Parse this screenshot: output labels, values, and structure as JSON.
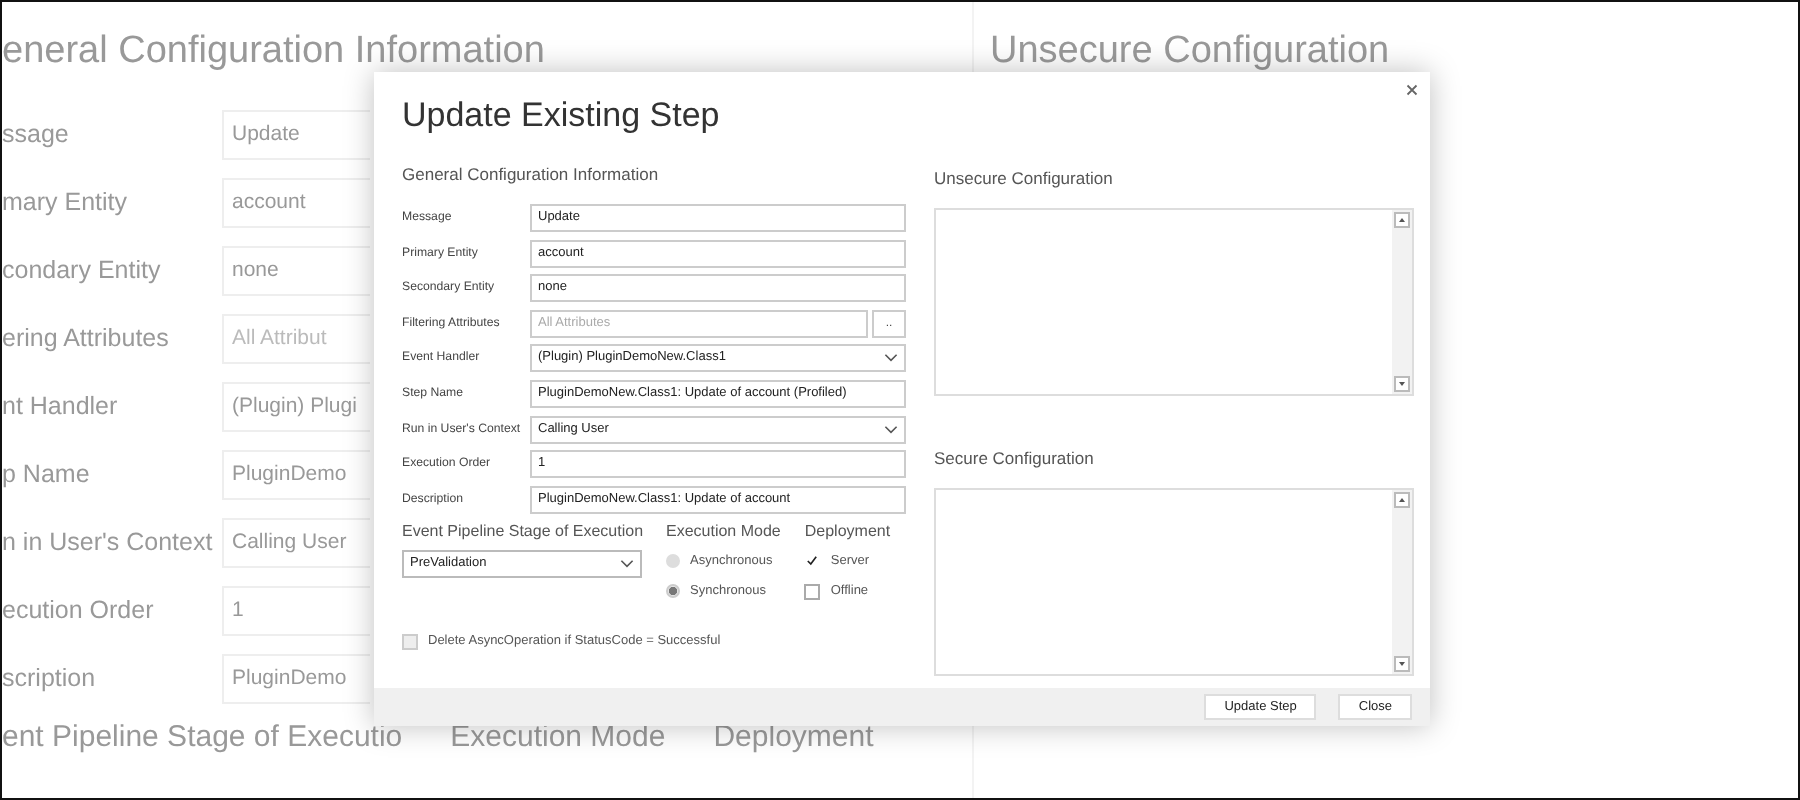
{
  "background_page": {
    "title": "eneral Configuration Information",
    "right_title": "Unsecure  Configuration",
    "rows": [
      {
        "label": "ssage",
        "value": "Update"
      },
      {
        "label": "mary Entity",
        "value": "account"
      },
      {
        "label": "condary Entity",
        "value": "none"
      },
      {
        "label": "ering Attributes",
        "placeholder": "All Attribut"
      },
      {
        "label": "nt Handler",
        "value": "(Plugin) Plugi"
      },
      {
        "label": "p Name",
        "value": "PluginDemo"
      },
      {
        "label": "n in User's Context",
        "value": "Calling User"
      },
      {
        "label": "ecution Order",
        "value": "1"
      },
      {
        "label": "scription",
        "value": "PluginDemo"
      }
    ],
    "bottom_headings": [
      "ent Pipeline Stage of Executio",
      "Execution Mode",
      "Deployment"
    ]
  },
  "dialog": {
    "title": "Update Existing Step",
    "general_heading": "General Configuration Information",
    "fields": [
      {
        "kind": "text",
        "label": "Message",
        "value": "Update"
      },
      {
        "kind": "text",
        "label": "Primary Entity",
        "value": "account"
      },
      {
        "kind": "text",
        "label": "Secondary Entity",
        "value": "none"
      },
      {
        "kind": "lookup",
        "label": "Filtering Attributes",
        "placeholder": "All Attributes",
        "button": ".."
      },
      {
        "kind": "select",
        "label": "Event Handler",
        "value": "(Plugin) PluginDemoNew.Class1"
      },
      {
        "kind": "text",
        "label": "Step Name",
        "value": "PluginDemoNew.Class1: Update of account (Profiled)"
      },
      {
        "kind": "select",
        "label": "Run in User's Context",
        "value": "Calling User"
      },
      {
        "kind": "text",
        "label": "Execution Order",
        "value": "1"
      },
      {
        "kind": "text",
        "label": "Description",
        "value": "PluginDemoNew.Class1: Update of account"
      }
    ],
    "pipeline": {
      "heading": "Event Pipeline Stage of Execution",
      "value": "PreValidation"
    },
    "execution_mode": {
      "heading": "Execution Mode",
      "options": [
        {
          "label": "Asynchronous",
          "selected": false
        },
        {
          "label": "Synchronous",
          "selected": true
        }
      ]
    },
    "deployment": {
      "heading": "Deployment",
      "options": [
        {
          "label": "Server",
          "checked": true
        },
        {
          "label": "Offline",
          "checked": false
        }
      ]
    },
    "delete_async": {
      "label": "Delete AsyncOperation if StatusCode = Successful",
      "checked": false
    },
    "unsecure": {
      "heading": "Unsecure  Configuration"
    },
    "secure": {
      "heading": "Secure  Configuration"
    },
    "buttons": [
      "Update Step",
      "Close"
    ]
  }
}
